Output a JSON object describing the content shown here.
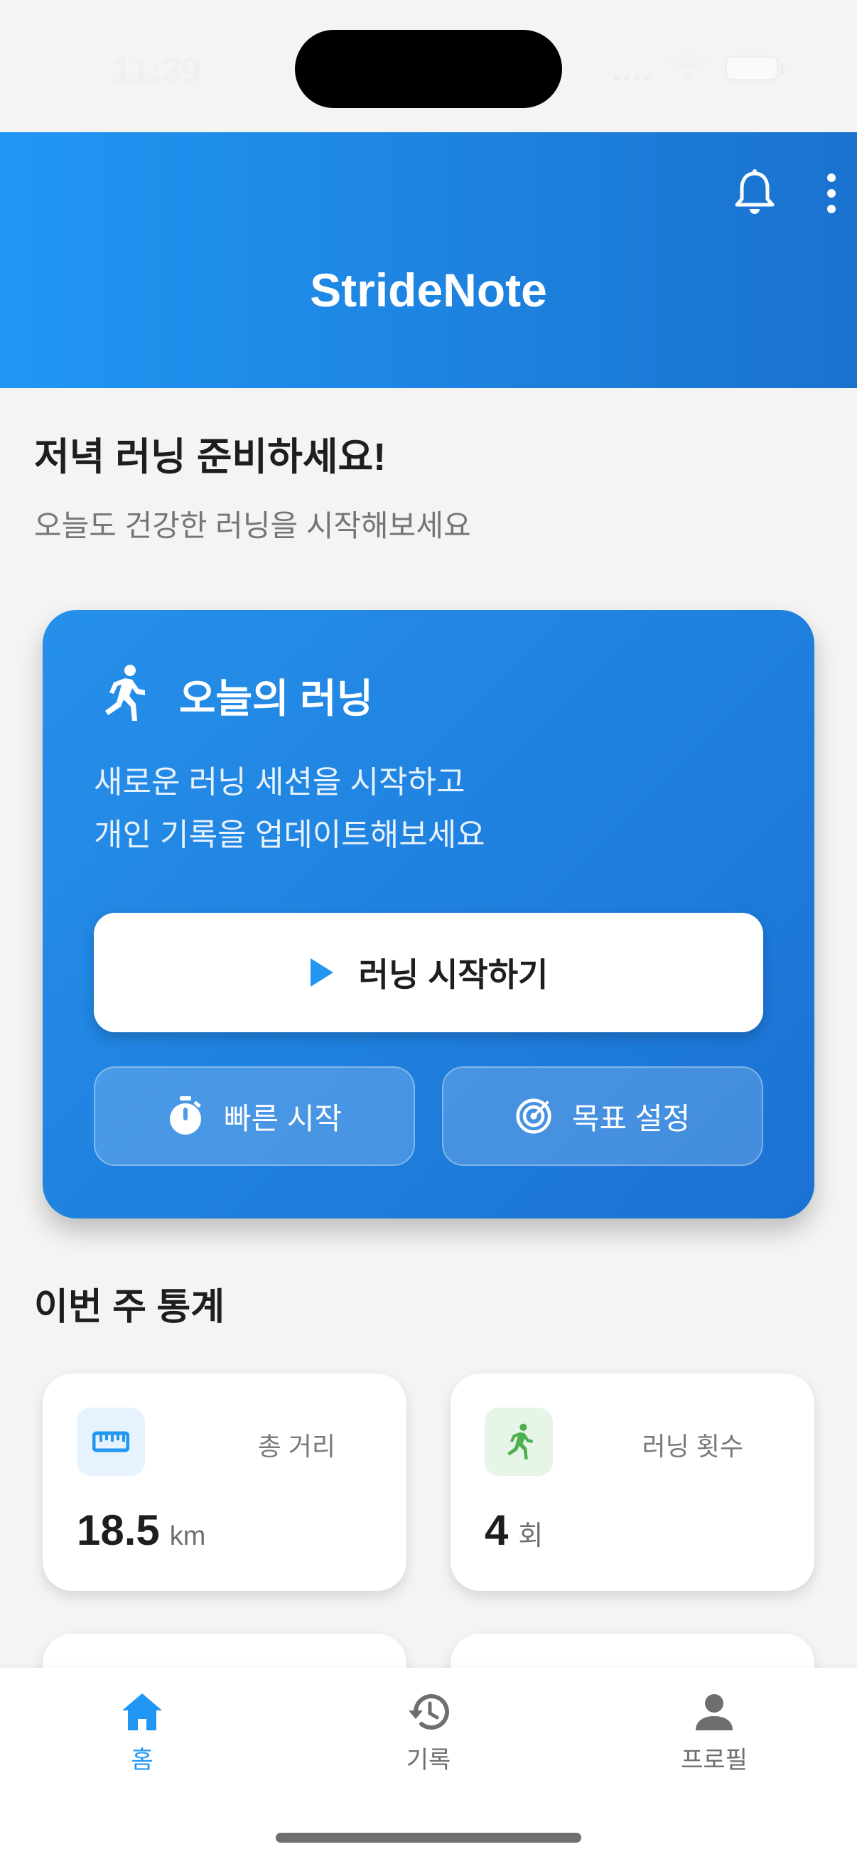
{
  "status_bar": {
    "time": "11:39"
  },
  "header": {
    "title": "StrideNote",
    "icons": [
      "bell-icon",
      "more-vert-icon"
    ]
  },
  "greeting": {
    "title": "저녁 러닝 준비하세요!",
    "subtitle": "오늘도 건강한 러닝을 시작해보세요"
  },
  "hero": {
    "title": "오늘의 러닝",
    "description": [
      "새로운 러닝 세션을 시작하고",
      "개인 기록을 업데이트해보세요"
    ],
    "start_label": "러닝 시작하기",
    "quick_start_label": "빠른 시작",
    "goal_label": "목표 설정"
  },
  "weekly": {
    "title": "이번 주 통계",
    "stats": [
      {
        "label": "총 거리",
        "value": "18.5",
        "unit": "km",
        "icon": "ruler-icon"
      },
      {
        "label": "러닝 횟수",
        "value": "4",
        "unit": "회",
        "icon": "runner-icon"
      }
    ]
  },
  "nav": {
    "items": [
      {
        "label": "홈",
        "icon": "home-icon",
        "active": true
      },
      {
        "label": "기록",
        "icon": "history-icon",
        "active": false
      },
      {
        "label": "프로필",
        "icon": "person-icon",
        "active": false
      }
    ]
  },
  "colors": {
    "primary": "#2196f3",
    "header_gradient_end": "#1a72cf",
    "green": "#4caf50",
    "background": "#f4f4f4"
  }
}
